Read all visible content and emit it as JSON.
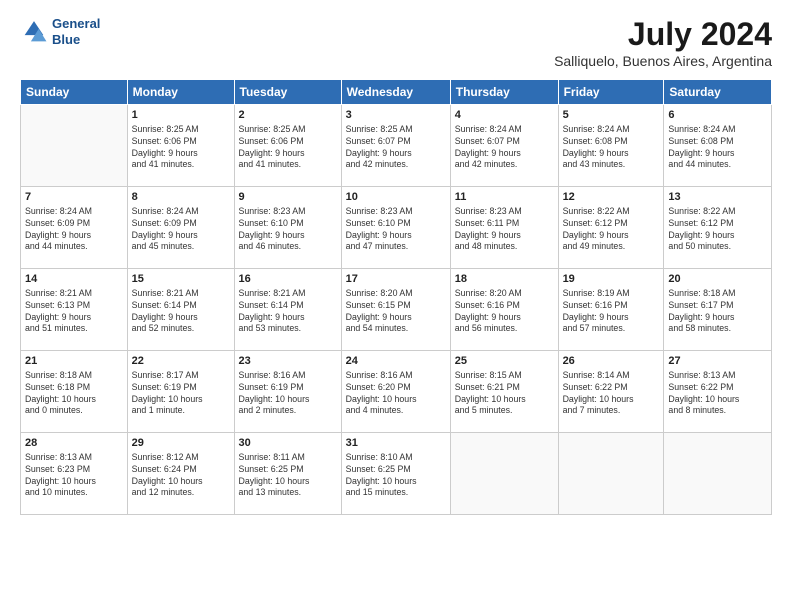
{
  "header": {
    "logo_line1": "General",
    "logo_line2": "Blue",
    "main_title": "July 2024",
    "subtitle": "Salliquelo, Buenos Aires, Argentina"
  },
  "weekdays": [
    "Sunday",
    "Monday",
    "Tuesday",
    "Wednesday",
    "Thursday",
    "Friday",
    "Saturday"
  ],
  "weeks": [
    [
      {
        "day": "",
        "info": ""
      },
      {
        "day": "1",
        "info": "Sunrise: 8:25 AM\nSunset: 6:06 PM\nDaylight: 9 hours\nand 41 minutes."
      },
      {
        "day": "2",
        "info": "Sunrise: 8:25 AM\nSunset: 6:06 PM\nDaylight: 9 hours\nand 41 minutes."
      },
      {
        "day": "3",
        "info": "Sunrise: 8:25 AM\nSunset: 6:07 PM\nDaylight: 9 hours\nand 42 minutes."
      },
      {
        "day": "4",
        "info": "Sunrise: 8:24 AM\nSunset: 6:07 PM\nDaylight: 9 hours\nand 42 minutes."
      },
      {
        "day": "5",
        "info": "Sunrise: 8:24 AM\nSunset: 6:08 PM\nDaylight: 9 hours\nand 43 minutes."
      },
      {
        "day": "6",
        "info": "Sunrise: 8:24 AM\nSunset: 6:08 PM\nDaylight: 9 hours\nand 44 minutes."
      }
    ],
    [
      {
        "day": "7",
        "info": "Sunrise: 8:24 AM\nSunset: 6:09 PM\nDaylight: 9 hours\nand 44 minutes."
      },
      {
        "day": "8",
        "info": "Sunrise: 8:24 AM\nSunset: 6:09 PM\nDaylight: 9 hours\nand 45 minutes."
      },
      {
        "day": "9",
        "info": "Sunrise: 8:23 AM\nSunset: 6:10 PM\nDaylight: 9 hours\nand 46 minutes."
      },
      {
        "day": "10",
        "info": "Sunrise: 8:23 AM\nSunset: 6:10 PM\nDaylight: 9 hours\nand 47 minutes."
      },
      {
        "day": "11",
        "info": "Sunrise: 8:23 AM\nSunset: 6:11 PM\nDaylight: 9 hours\nand 48 minutes."
      },
      {
        "day": "12",
        "info": "Sunrise: 8:22 AM\nSunset: 6:12 PM\nDaylight: 9 hours\nand 49 minutes."
      },
      {
        "day": "13",
        "info": "Sunrise: 8:22 AM\nSunset: 6:12 PM\nDaylight: 9 hours\nand 50 minutes."
      }
    ],
    [
      {
        "day": "14",
        "info": "Sunrise: 8:21 AM\nSunset: 6:13 PM\nDaylight: 9 hours\nand 51 minutes."
      },
      {
        "day": "15",
        "info": "Sunrise: 8:21 AM\nSunset: 6:14 PM\nDaylight: 9 hours\nand 52 minutes."
      },
      {
        "day": "16",
        "info": "Sunrise: 8:21 AM\nSunset: 6:14 PM\nDaylight: 9 hours\nand 53 minutes."
      },
      {
        "day": "17",
        "info": "Sunrise: 8:20 AM\nSunset: 6:15 PM\nDaylight: 9 hours\nand 54 minutes."
      },
      {
        "day": "18",
        "info": "Sunrise: 8:20 AM\nSunset: 6:16 PM\nDaylight: 9 hours\nand 56 minutes."
      },
      {
        "day": "19",
        "info": "Sunrise: 8:19 AM\nSunset: 6:16 PM\nDaylight: 9 hours\nand 57 minutes."
      },
      {
        "day": "20",
        "info": "Sunrise: 8:18 AM\nSunset: 6:17 PM\nDaylight: 9 hours\nand 58 minutes."
      }
    ],
    [
      {
        "day": "21",
        "info": "Sunrise: 8:18 AM\nSunset: 6:18 PM\nDaylight: 10 hours\nand 0 minutes."
      },
      {
        "day": "22",
        "info": "Sunrise: 8:17 AM\nSunset: 6:19 PM\nDaylight: 10 hours\nand 1 minute."
      },
      {
        "day": "23",
        "info": "Sunrise: 8:16 AM\nSunset: 6:19 PM\nDaylight: 10 hours\nand 2 minutes."
      },
      {
        "day": "24",
        "info": "Sunrise: 8:16 AM\nSunset: 6:20 PM\nDaylight: 10 hours\nand 4 minutes."
      },
      {
        "day": "25",
        "info": "Sunrise: 8:15 AM\nSunset: 6:21 PM\nDaylight: 10 hours\nand 5 minutes."
      },
      {
        "day": "26",
        "info": "Sunrise: 8:14 AM\nSunset: 6:22 PM\nDaylight: 10 hours\nand 7 minutes."
      },
      {
        "day": "27",
        "info": "Sunrise: 8:13 AM\nSunset: 6:22 PM\nDaylight: 10 hours\nand 8 minutes."
      }
    ],
    [
      {
        "day": "28",
        "info": "Sunrise: 8:13 AM\nSunset: 6:23 PM\nDaylight: 10 hours\nand 10 minutes."
      },
      {
        "day": "29",
        "info": "Sunrise: 8:12 AM\nSunset: 6:24 PM\nDaylight: 10 hours\nand 12 minutes."
      },
      {
        "day": "30",
        "info": "Sunrise: 8:11 AM\nSunset: 6:25 PM\nDaylight: 10 hours\nand 13 minutes."
      },
      {
        "day": "31",
        "info": "Sunrise: 8:10 AM\nSunset: 6:25 PM\nDaylight: 10 hours\nand 15 minutes."
      },
      {
        "day": "",
        "info": ""
      },
      {
        "day": "",
        "info": ""
      },
      {
        "day": "",
        "info": ""
      }
    ]
  ]
}
